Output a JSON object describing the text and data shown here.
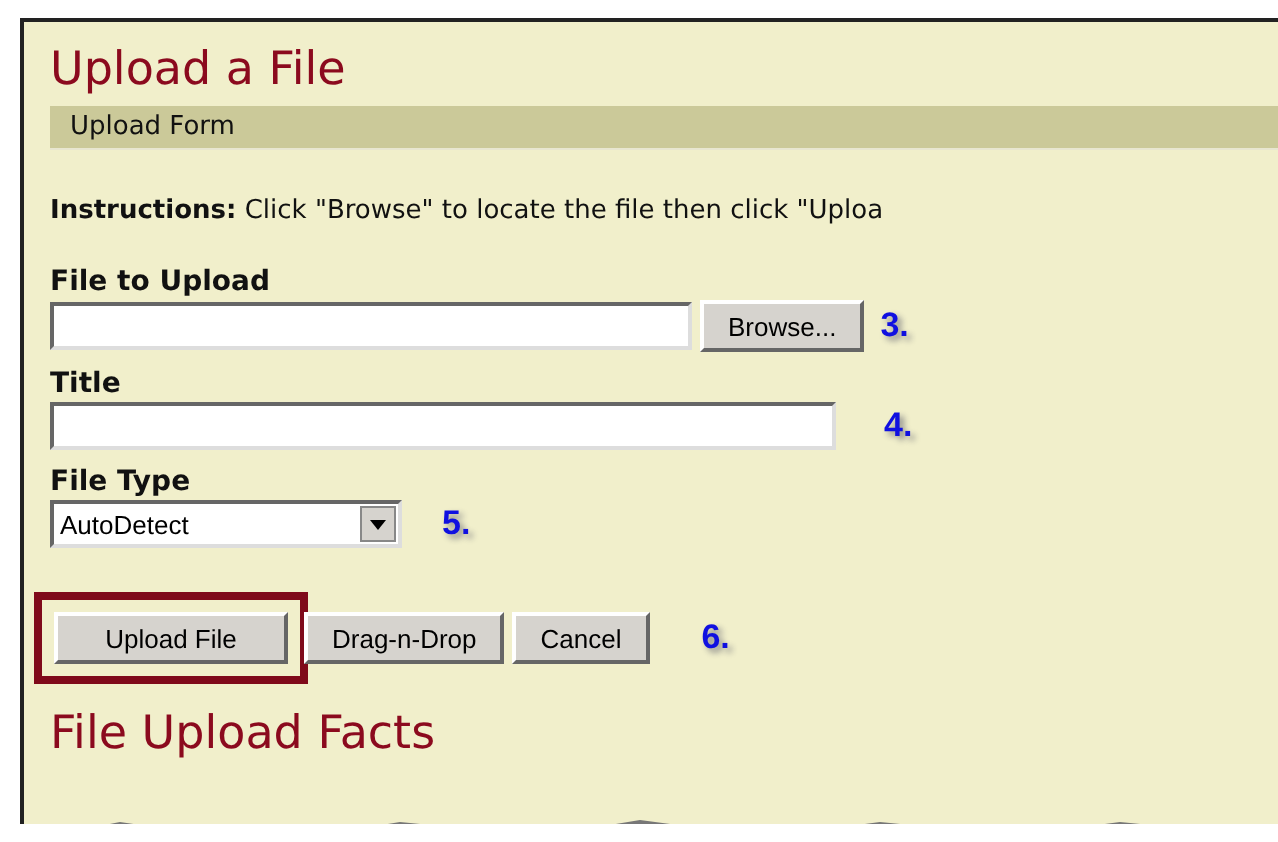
{
  "page_title": "Upload a File",
  "section_bar": "Upload Form",
  "instructions": {
    "label": "Instructions:",
    "text": "Click \"Browse\" to locate the file then click \"Uploa"
  },
  "fields": [
    {
      "kind": "file",
      "label": "File to Upload",
      "button": "Browse...",
      "annotation": "3."
    },
    {
      "kind": "text",
      "label": "Title",
      "annotation": "4."
    },
    {
      "kind": "select",
      "label": "File Type",
      "value": "AutoDetect",
      "annotation": "5."
    }
  ],
  "buttons": [
    {
      "label": "Upload File",
      "highlighted": true
    },
    {
      "label": "Drag-n-Drop",
      "highlighted": false
    },
    {
      "label": "Cancel",
      "highlighted": false
    }
  ],
  "buttons_annotation": "6.",
  "next_heading": "File Upload Facts"
}
